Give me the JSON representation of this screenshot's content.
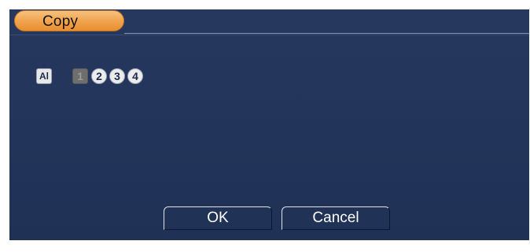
{
  "dialog": {
    "title": "Copy"
  },
  "channels": {
    "all_label": "Al",
    "items": [
      "1",
      "2",
      "3",
      "4"
    ]
  },
  "buttons": {
    "ok_label": "OK",
    "cancel_label": "Cancel"
  },
  "colors": {
    "dialog_bg": "#223459",
    "title_tab": "#f0a24c",
    "text": "#ffffff"
  }
}
